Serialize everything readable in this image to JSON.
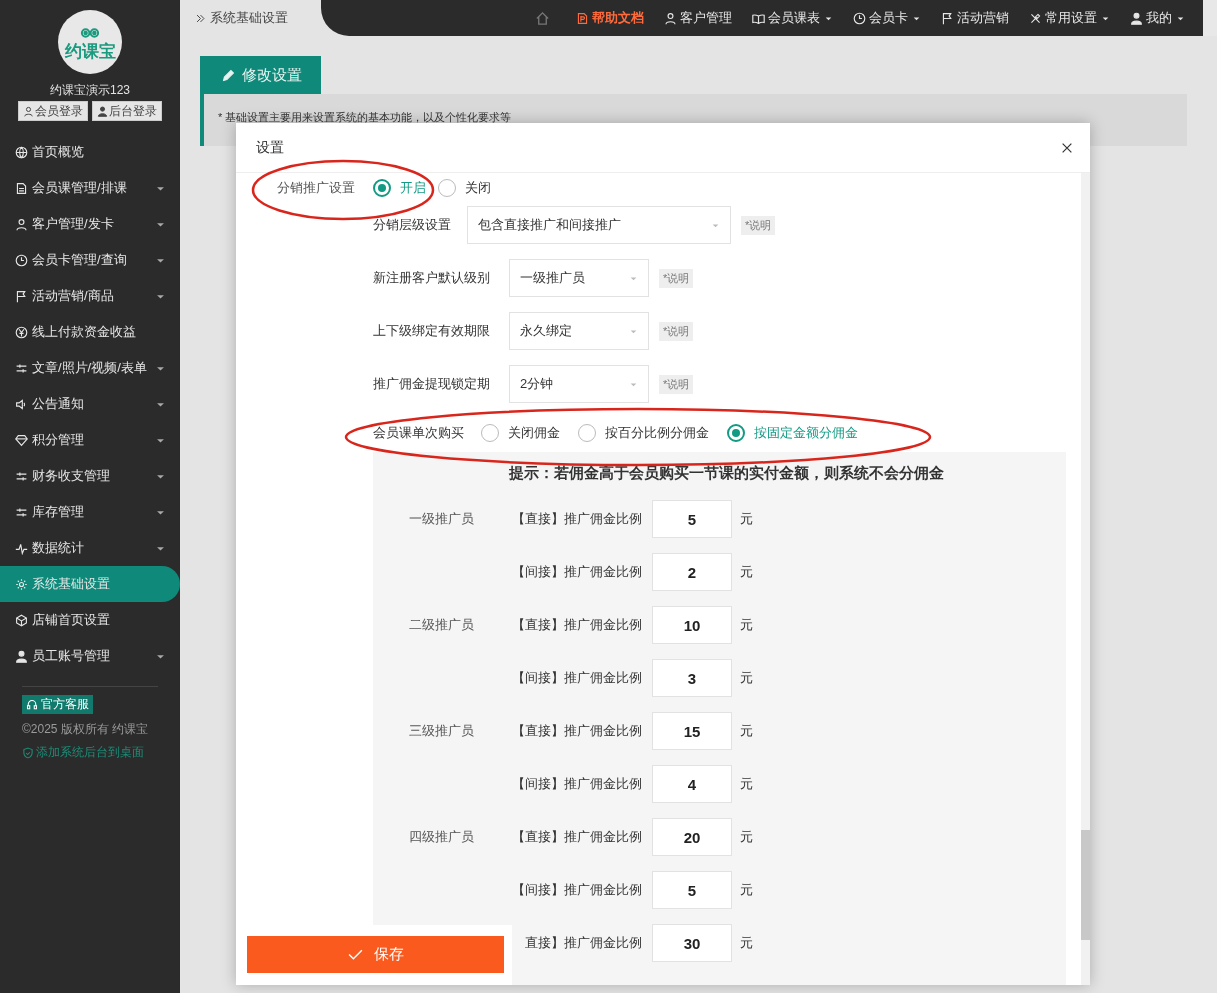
{
  "sidebar": {
    "logo_text": "约课宝",
    "account": "约课宝演示123",
    "login_buttons": [
      "会员登录",
      "后台登录"
    ],
    "items": [
      {
        "label": "首页概览",
        "expandable": false,
        "selected": false
      },
      {
        "label": "会员课管理/排课",
        "expandable": true,
        "selected": false
      },
      {
        "label": "客户管理/发卡",
        "expandable": true,
        "selected": false
      },
      {
        "label": "会员卡管理/查询",
        "expandable": true,
        "selected": false
      },
      {
        "label": "活动营销/商品",
        "expandable": true,
        "selected": false
      },
      {
        "label": "线上付款资金收益",
        "expandable": false,
        "selected": false
      },
      {
        "label": "文章/照片/视频/表单",
        "expandable": true,
        "selected": false
      },
      {
        "label": "公告通知",
        "expandable": true,
        "selected": false
      },
      {
        "label": "积分管理",
        "expandable": true,
        "selected": false
      },
      {
        "label": "财务收支管理",
        "expandable": true,
        "selected": false
      },
      {
        "label": "库存管理",
        "expandable": true,
        "selected": false
      },
      {
        "label": "数据统计",
        "expandable": true,
        "selected": false
      },
      {
        "label": "系统基础设置",
        "expandable": false,
        "selected": true
      },
      {
        "label": "店铺首页设置",
        "expandable": false,
        "selected": false
      },
      {
        "label": "员工账号管理",
        "expandable": true,
        "selected": false
      }
    ],
    "support_badge": "官方客服",
    "copyright": "©2025 版权所有 约课宝",
    "add_to_desktop": "添加系统后台到桌面"
  },
  "breadcrumb": "系统基础设置",
  "topnav": [
    {
      "label": "帮助文档",
      "highlighted": true,
      "dropdown": false
    },
    {
      "label": "客户管理",
      "highlighted": false,
      "dropdown": false
    },
    {
      "label": "会员课表",
      "highlighted": false,
      "dropdown": true
    },
    {
      "label": "会员卡",
      "highlighted": false,
      "dropdown": true
    },
    {
      "label": "活动营销",
      "highlighted": false,
      "dropdown": false
    },
    {
      "label": "常用设置",
      "highlighted": false,
      "dropdown": true
    },
    {
      "label": "我的",
      "highlighted": false,
      "dropdown": true
    }
  ],
  "page": {
    "tab": "修改设置",
    "notice": "* 基础设置主要用来设置系统的基本功能，以及个性化要求等"
  },
  "modal": {
    "title": "设置",
    "distribution": {
      "label": "分销推广设置",
      "options": [
        {
          "label": "开启",
          "selected": true
        },
        {
          "label": "关闭",
          "selected": false
        }
      ]
    },
    "selects": [
      {
        "label": "分销层级设置",
        "value": "包含直接推广和间接推广",
        "note": "*说明",
        "kind": "wide"
      },
      {
        "label": "新注册客户默认级别",
        "value": "一级推广员",
        "note": "*说明",
        "kind": "narrow"
      },
      {
        "label": "上下级绑定有效期限",
        "value": "永久绑定",
        "note": "*说明",
        "kind": "narrow"
      },
      {
        "label": "推广佣金提现锁定期",
        "value": "2分钟",
        "note": "*说明",
        "kind": "narrow"
      }
    ],
    "purchase": {
      "label": "会员课单次购买",
      "options": [
        {
          "label": "关闭佣金",
          "selected": false
        },
        {
          "label": "按百分比例分佣金",
          "selected": false
        },
        {
          "label": "按固定金额分佣金",
          "selected": true
        }
      ]
    },
    "tip": "提示：若佣金高于会员购买一节课的实付金额，则系统不会分佣金",
    "levels": [
      {
        "name": "一级推广员",
        "rows": [
          {
            "label": "【直接】推广佣金比例",
            "value": "5",
            "unit": "元"
          },
          {
            "label": "【间接】推广佣金比例",
            "value": "2",
            "unit": "元"
          }
        ]
      },
      {
        "name": "二级推广员",
        "rows": [
          {
            "label": "【直接】推广佣金比例",
            "value": "10",
            "unit": "元"
          },
          {
            "label": "【间接】推广佣金比例",
            "value": "3",
            "unit": "元"
          }
        ]
      },
      {
        "name": "三级推广员",
        "rows": [
          {
            "label": "【直接】推广佣金比例",
            "value": "15",
            "unit": "元"
          },
          {
            "label": "【间接】推广佣金比例",
            "value": "4",
            "unit": "元"
          }
        ]
      },
      {
        "name": "四级推广员",
        "rows": [
          {
            "label": "【直接】推广佣金比例",
            "value": "20",
            "unit": "元"
          },
          {
            "label": "【间接】推广佣金比例",
            "value": "5",
            "unit": "元"
          }
        ]
      },
      {
        "rows": [
          {
            "label": "直接】推广佣金比例",
            "value": "30",
            "unit": "元"
          }
        ]
      }
    ],
    "save": "保存"
  }
}
